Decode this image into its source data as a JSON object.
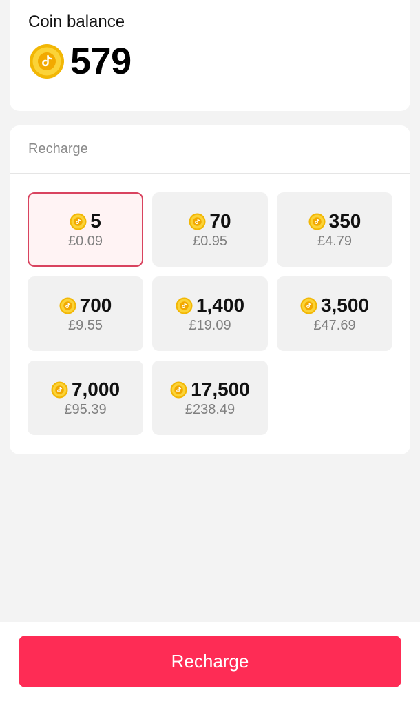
{
  "balance": {
    "title": "Coin balance",
    "amount": "579",
    "icon": "tiktok-coin-icon"
  },
  "recharge_section": {
    "title": "Recharge",
    "packages": [
      {
        "coins": "5",
        "price": "£0.09",
        "selected": true
      },
      {
        "coins": "70",
        "price": "£0.95",
        "selected": false
      },
      {
        "coins": "350",
        "price": "£4.79",
        "selected": false
      },
      {
        "coins": "700",
        "price": "£9.55",
        "selected": false
      },
      {
        "coins": "1,400",
        "price": "£19.09",
        "selected": false
      },
      {
        "coins": "3,500",
        "price": "£47.69",
        "selected": false
      },
      {
        "coins": "7,000",
        "price": "£95.39",
        "selected": false
      },
      {
        "coins": "17,500",
        "price": "£238.49",
        "selected": false
      }
    ]
  },
  "footer": {
    "button_label": "Recharge"
  },
  "colors": {
    "accent": "#fe2c55",
    "coin_gold": "#f7c81e",
    "selected_border": "#d9435f",
    "selected_bg": "#fff3f4"
  }
}
